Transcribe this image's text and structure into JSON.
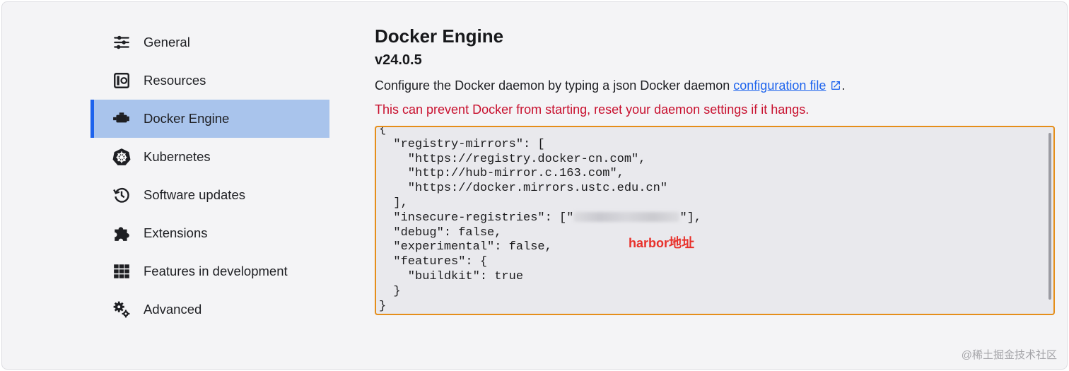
{
  "sidebar": {
    "items": [
      {
        "label": "General",
        "icon": "sliders-icon"
      },
      {
        "label": "Resources",
        "icon": "resources-icon"
      },
      {
        "label": "Docker Engine",
        "icon": "engine-icon",
        "active": true
      },
      {
        "label": "Kubernetes",
        "icon": "kubernetes-icon"
      },
      {
        "label": "Software updates",
        "icon": "history-icon"
      },
      {
        "label": "Extensions",
        "icon": "puzzle-icon"
      },
      {
        "label": "Features in development",
        "icon": "grid-icon"
      },
      {
        "label": "Advanced",
        "icon": "gears-icon"
      }
    ]
  },
  "main": {
    "title": "Docker Engine",
    "version": "v24.0.5",
    "description_prefix": "Configure the Docker daemon by typing a json Docker daemon ",
    "description_link": "configuration file",
    "description_suffix": ".",
    "warning": "This can prevent Docker from starting, reset your daemon settings if it hangs.",
    "editor": {
      "lines_before": "{\n  \"registry-mirrors\": [\n    \"https://registry.docker-cn.com\",\n    \"http://hub-mirror.c.163.com\",\n    \"https://docker.mirrors.ustc.edu.cn\"\n  ],\n  \"insecure-registries\": [\"",
      "lines_after": "\"],\n  \"debug\": false,\n  \"experimental\": false,\n  \"features\": {\n    \"buildkit\": true\n  }\n}",
      "annotation": "harbor地址"
    }
  },
  "watermark": "@稀土掘金技术社区",
  "colors": {
    "accent": "#1d63ed",
    "active_bg": "#a9c4ec",
    "warning": "#c8102e",
    "editor_border": "#e58e1a",
    "annotation": "#e8302a"
  }
}
